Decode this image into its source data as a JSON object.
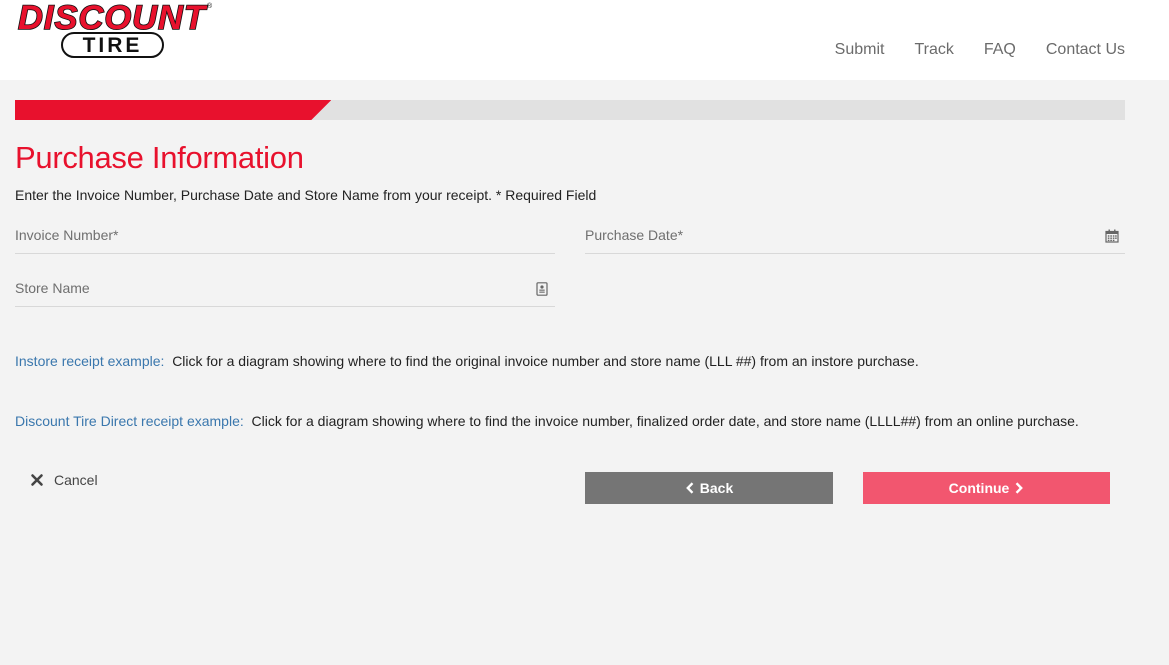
{
  "brand": {
    "logo_line1": "DISCOUNT",
    "logo_line2": "TIRE",
    "logo_mark": "®",
    "primary_color": "#e8112d",
    "logo_icon": "discount-tire-logo"
  },
  "nav": {
    "items": [
      {
        "label": "Submit"
      },
      {
        "label": "Track"
      },
      {
        "label": "FAQ"
      },
      {
        "label": "Contact Us"
      }
    ]
  },
  "progress": {
    "fraction": 0.285
  },
  "page": {
    "title": "Purchase Information",
    "subtitle": "Enter the Invoice Number, Purchase Date and Store Name from your receipt. * Required Field"
  },
  "form": {
    "invoice": {
      "placeholder": "Invoice Number*",
      "value": ""
    },
    "purchase_date": {
      "placeholder": "Purchase Date*",
      "value": "",
      "icon": "calendar-icon"
    },
    "store_name": {
      "placeholder": "Store Name",
      "value": "",
      "icon": "store-list-icon"
    }
  },
  "receipts": {
    "instore": {
      "link": "Instore receipt example:",
      "desc": "Click for a diagram showing where to find the original invoice number and store name (LLL  ##) from an instore purchase."
    },
    "direct": {
      "link": "Discount Tire Direct receipt example:",
      "desc": "Click for a diagram showing where to find the invoice number, finalized order date, and store name (LLLL##) from an online purchase."
    }
  },
  "actions": {
    "cancel_label": "Cancel",
    "back_label": "Back",
    "continue_label": "Continue",
    "back_color": "#757575",
    "continue_color": "#f2566f"
  }
}
